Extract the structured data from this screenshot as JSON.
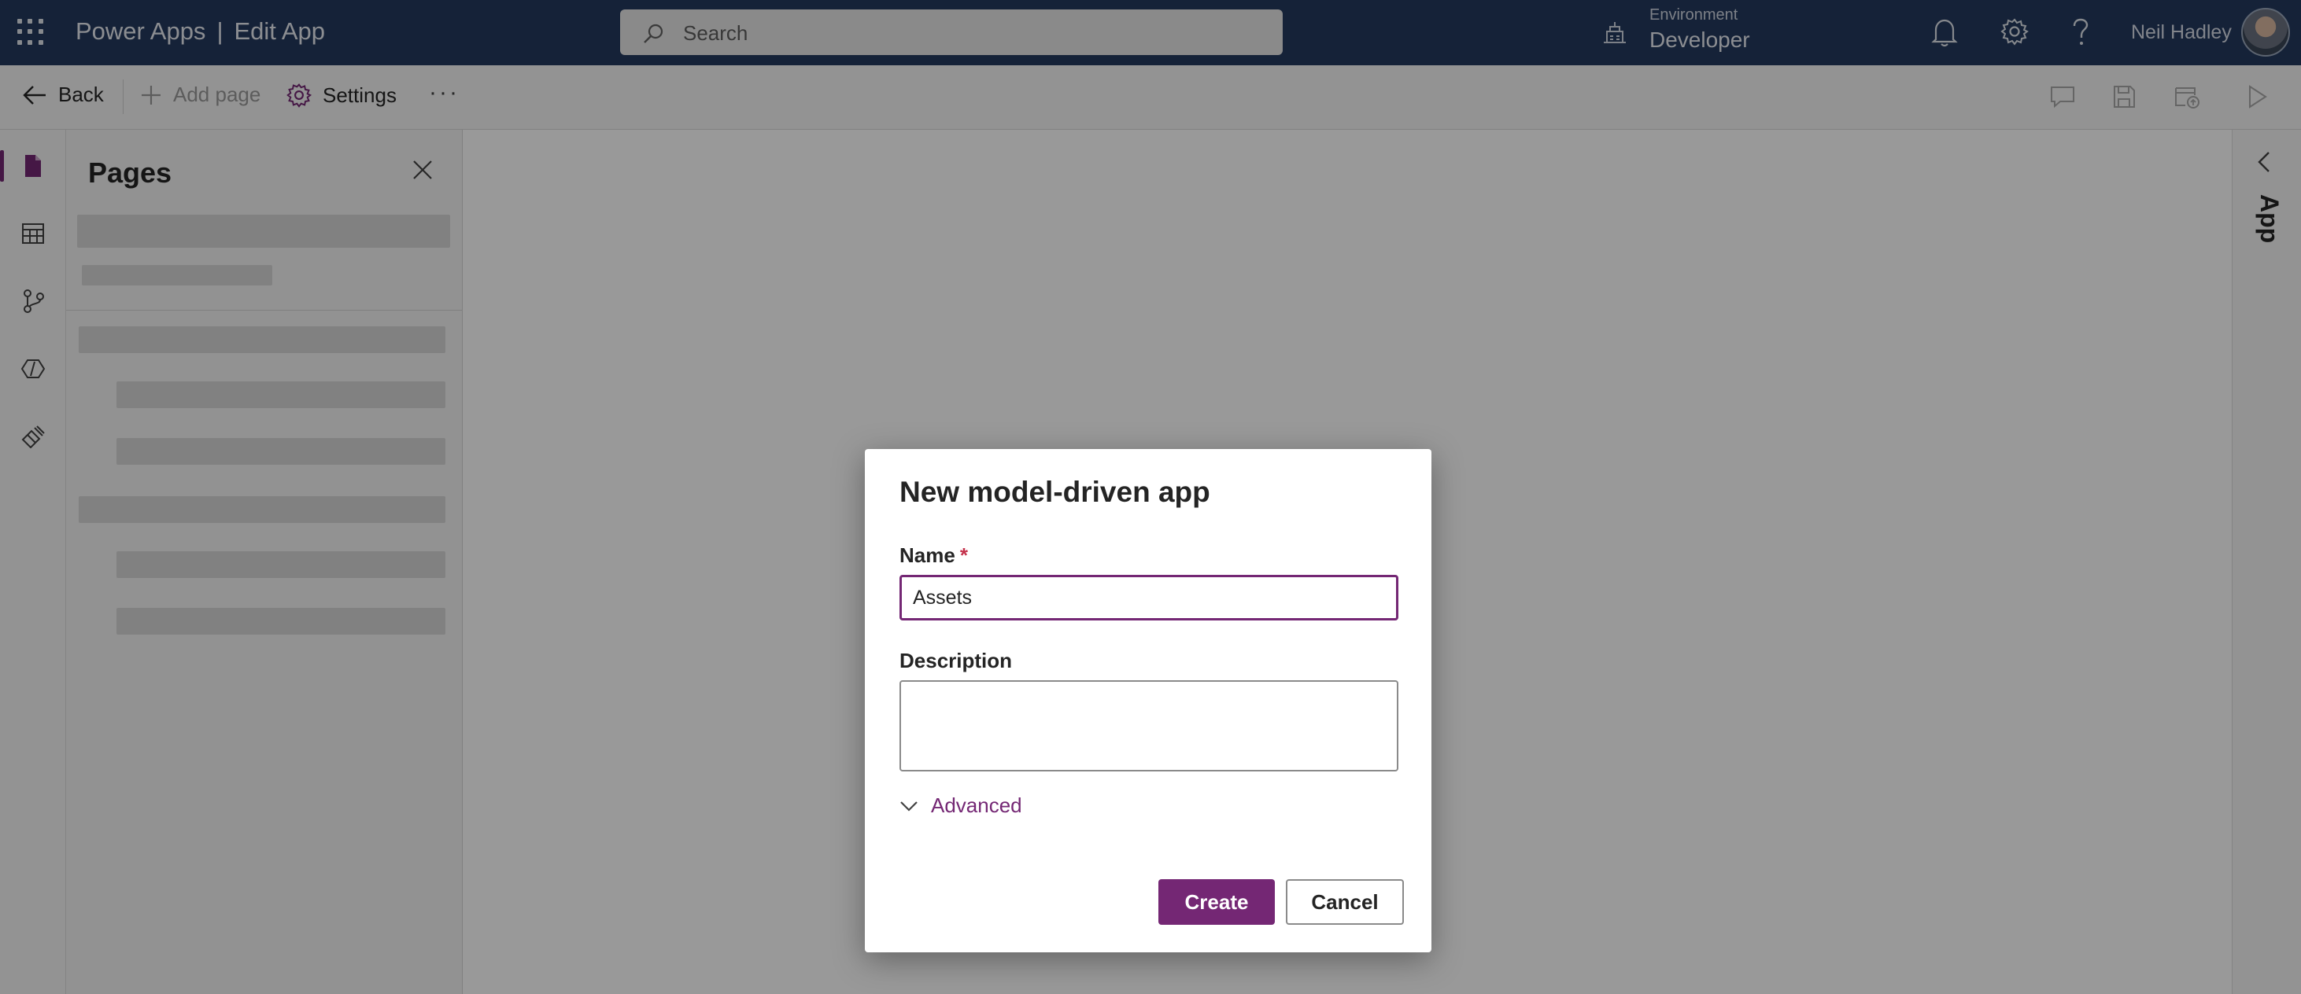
{
  "header": {
    "app_name": "Power Apps",
    "separator": "|",
    "page_name": "Edit App",
    "search_placeholder": "Search",
    "environment_label": "Environment",
    "environment_name": "Developer",
    "user_name": "Neil Hadley"
  },
  "command_bar": {
    "back_label": "Back",
    "add_page_label": "Add page",
    "settings_label": "Settings",
    "more_label": "···"
  },
  "pages_panel": {
    "title": "Pages"
  },
  "right_panel": {
    "label": "App"
  },
  "dialog": {
    "title": "New model-driven app",
    "name_label": "Name",
    "required_marker": "*",
    "name_value": "Assets",
    "description_label": "Description",
    "description_value": "",
    "advanced_label": "Advanced",
    "create_label": "Create",
    "cancel_label": "Cancel"
  },
  "colors": {
    "header_bg": "#243a5e",
    "accent": "#742774",
    "required": "#c4314b"
  }
}
